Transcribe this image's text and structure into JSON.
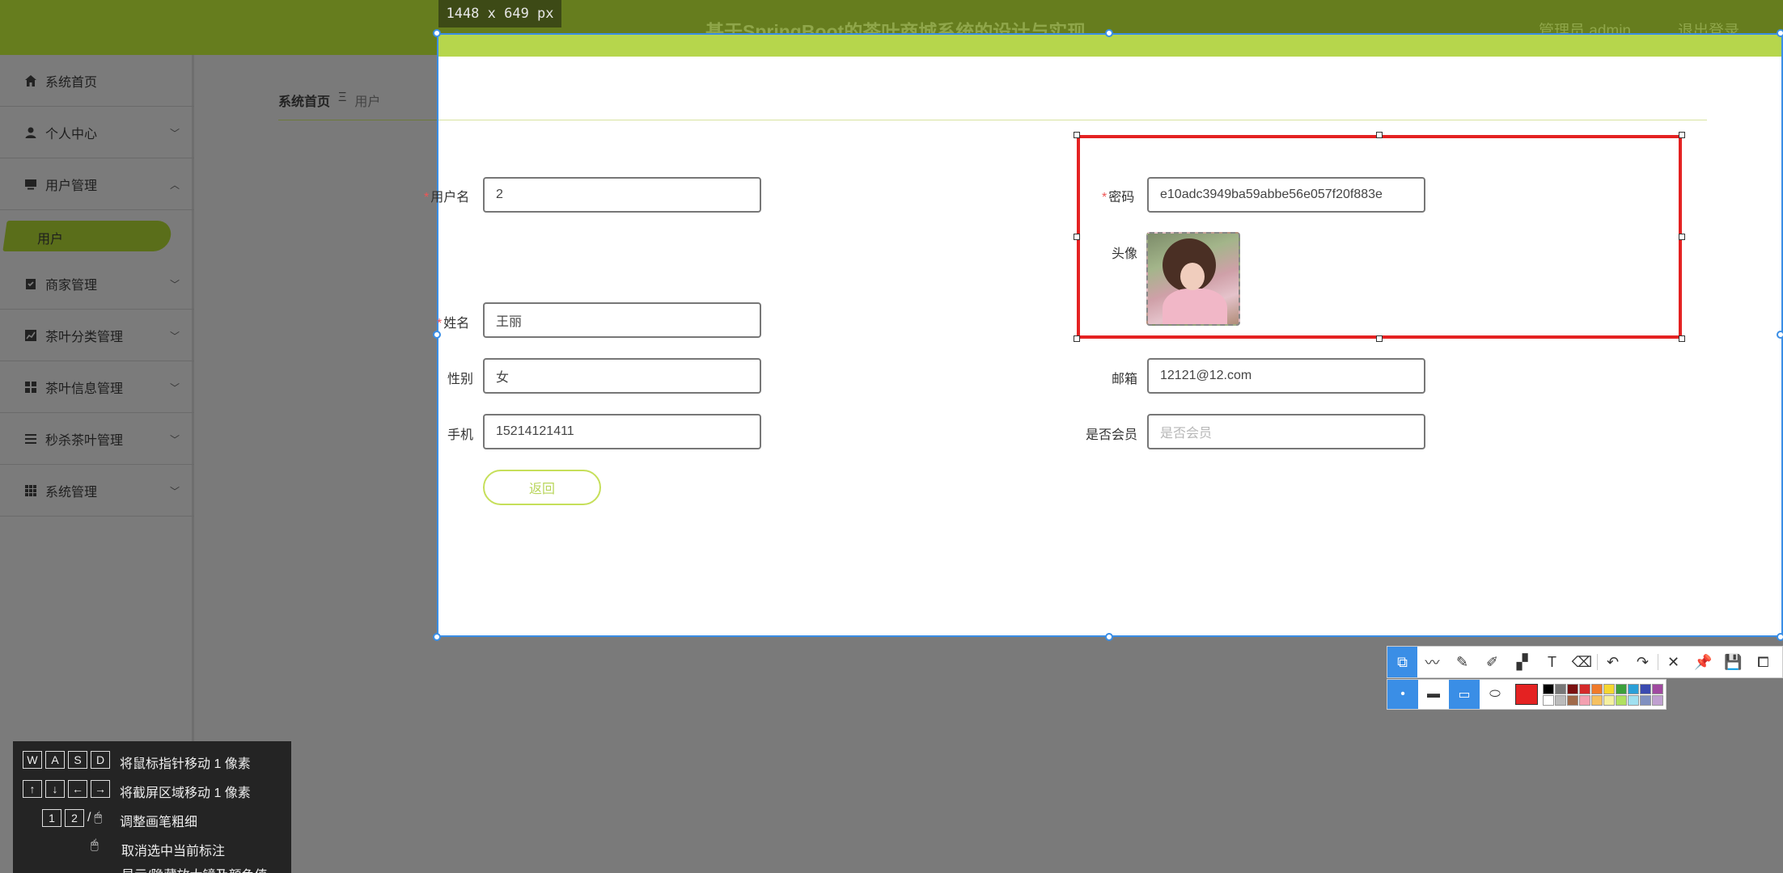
{
  "header": {
    "title": "基于SpringBoot的茶叶商城系统的设计与实现",
    "user": "管理员 admin",
    "logout": "退出登录"
  },
  "sidebar": {
    "items": [
      {
        "label": "系统首页",
        "icon": "home-icon"
      },
      {
        "label": "个人中心",
        "icon": "user-icon"
      },
      {
        "label": "用户管理",
        "icon": "monitor-icon"
      },
      {
        "label": "商家管理",
        "icon": "clipboard-icon"
      },
      {
        "label": "茶叶分类管理",
        "icon": "chart-icon"
      },
      {
        "label": "茶叶信息管理",
        "icon": "grid-icon"
      },
      {
        "label": "秒杀茶叶管理",
        "icon": "list-icon"
      },
      {
        "label": "系统管理",
        "icon": "apps-icon"
      }
    ],
    "sub_item": "用户"
  },
  "breadcrumb": {
    "home": "系统首页",
    "separator": "Ξ",
    "current": "用户"
  },
  "capture": {
    "size_label": "1448 x 649 px"
  },
  "form": {
    "username_label": "用户名",
    "username_value": "2",
    "password_label": "密码",
    "password_value": "e10adc3949ba59abbe56e057f20f883e",
    "avatar_label": "头像",
    "name_label": "姓名",
    "name_value": "王丽",
    "gender_label": "性别",
    "gender_value": "女",
    "email_label": "邮箱",
    "email_value": "12121@12.com",
    "phone_label": "手机",
    "phone_value": "15214121411",
    "member_label": "是否会员",
    "member_placeholder": "是否会员",
    "back_label": "返回"
  },
  "colors": {
    "accent": "#b6d64c",
    "annotation": "#e42222",
    "selection": "#3a8ee6"
  },
  "help": {
    "rows": [
      {
        "keys": [
          "W",
          "A",
          "S",
          "D"
        ],
        "text": "将鼠标指针移动 1 像素"
      },
      {
        "keys": [
          "↑",
          "↓",
          "←",
          "→"
        ],
        "text": "将截屏区域移动 1 像素"
      },
      {
        "keys": [
          "1",
          "2"
        ],
        "text": "调整画笔粗细"
      },
      {
        "keys": [],
        "text": "取消选中当前标注"
      },
      {
        "keys": [],
        "text": "显示/隐藏放大镜及颜色值"
      }
    ]
  }
}
